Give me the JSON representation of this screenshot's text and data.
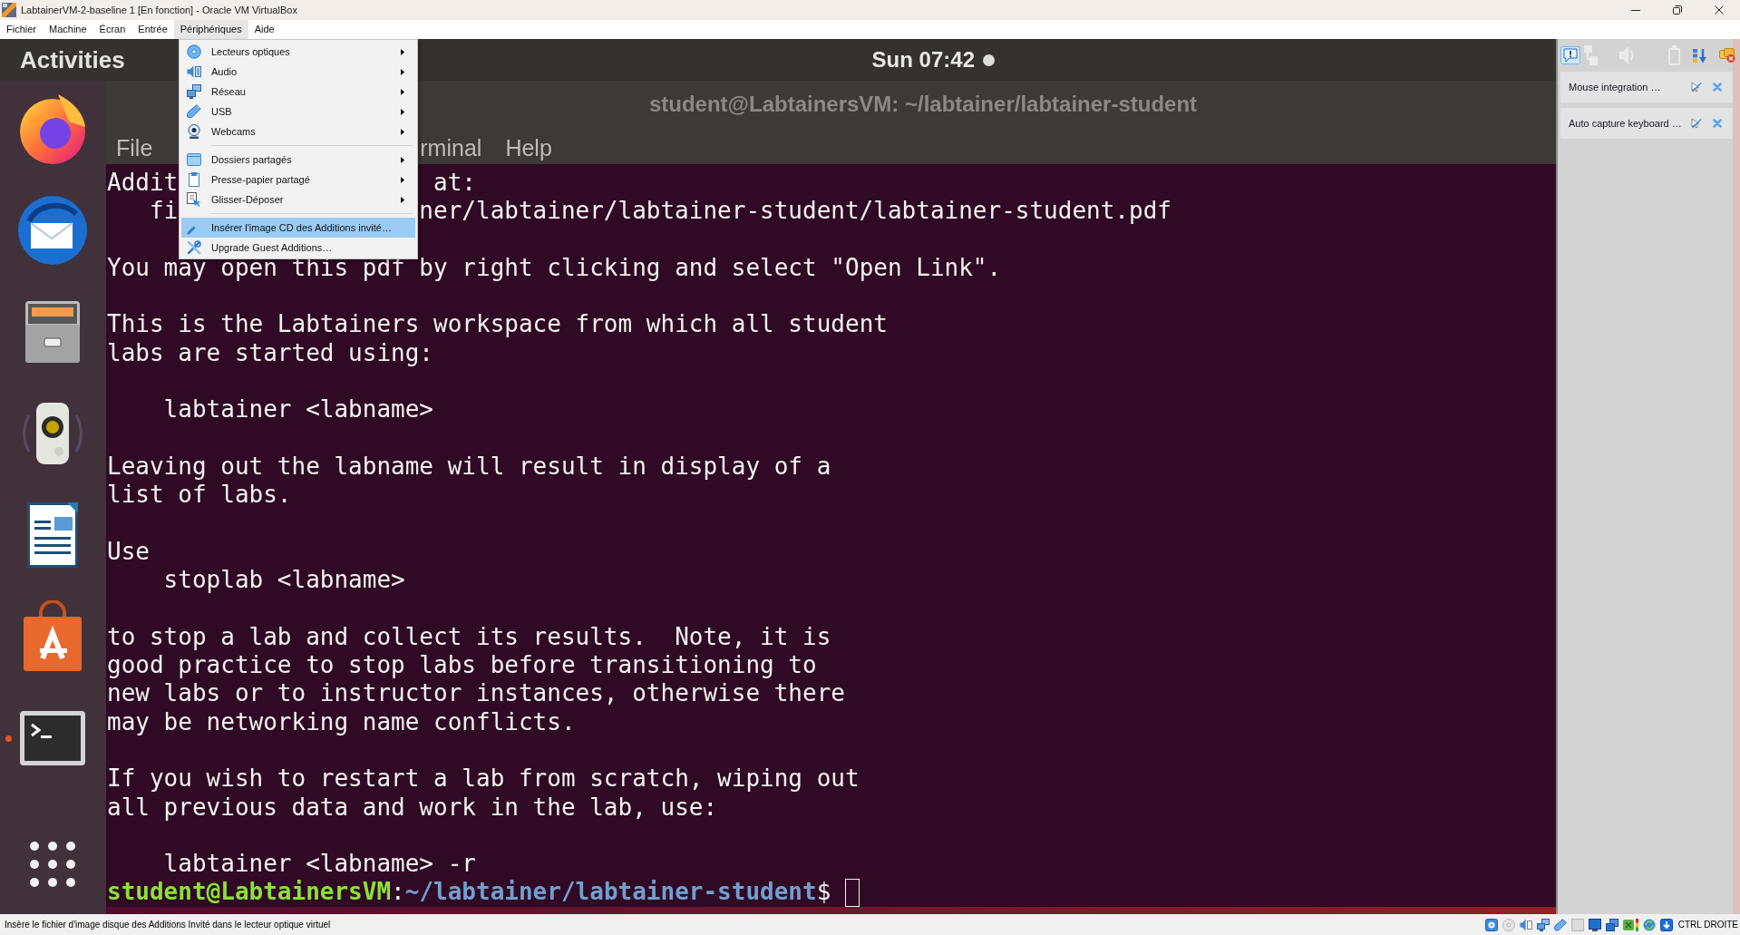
{
  "window": {
    "title": "LabtainerVM-2-baseline 1 [En fonction] - Oracle VM VirtualBox"
  },
  "menu_bar": [
    {
      "label": "Fichier",
      "selected": false
    },
    {
      "label": "Machine",
      "selected": false
    },
    {
      "label": "Écran",
      "selected": false
    },
    {
      "label": "Entrée",
      "selected": false
    },
    {
      "label": "Périphériques",
      "selected": true
    },
    {
      "label": "Aide",
      "selected": false
    }
  ],
  "dropdown": {
    "groups": [
      [
        {
          "label": "Lecteurs optiques",
          "submenu": true,
          "highlighted": false
        },
        {
          "label": "Audio",
          "submenu": true,
          "highlighted": false
        },
        {
          "label": "Réseau",
          "submenu": true,
          "highlighted": false
        },
        {
          "label": "USB",
          "submenu": true,
          "highlighted": false
        },
        {
          "label": "Webcams",
          "submenu": true,
          "highlighted": false
        }
      ],
      [
        {
          "label": "Dossiers partagés",
          "submenu": true,
          "highlighted": false
        },
        {
          "label": "Presse-papier partagé",
          "submenu": true,
          "highlighted": false
        },
        {
          "label": "Glisser-Déposer",
          "submenu": true,
          "highlighted": false
        }
      ],
      [
        {
          "label": "Insérer l'image CD des Additions invité…",
          "submenu": false,
          "highlighted": true
        },
        {
          "label": "Upgrade Guest Additions…",
          "submenu": false,
          "highlighted": false
        }
      ]
    ]
  },
  "vm": {
    "top_bar": {
      "activities": "Activities",
      "clock": "Sun 07:42"
    },
    "dock": {
      "items": [
        {
          "running": false
        },
        {
          "running": false
        },
        {
          "running": false
        },
        {
          "running": false
        },
        {
          "running": false
        },
        {
          "running": false
        },
        {
          "running": true
        }
      ]
    },
    "terminal": {
      "title": "student@LabtainersVM: ~/labtainer/labtainer-student",
      "menu": [
        "File",
        "rminal",
        "Help"
      ],
      "blocks": [
        [
          {
            "kind": "split",
            "segments": [
              "Addit",
              "at:"
            ]
          },
          {
            "kind": "split",
            "segments": [
              "fi",
              "ner/labtainer/labtainer-student/labtainer-student.pdf"
            ]
          }
        ],
        [
          {
            "kind": "plain",
            "text": "You may open this pdf by right clicking and select \"Open Link\"."
          }
        ],
        [
          {
            "kind": "plain",
            "text": "This is the Labtainers workspace from which all student"
          },
          {
            "kind": "plain",
            "text": "labs are started using:"
          }
        ],
        [
          {
            "kind": "indented",
            "text": "labtainer <labname>"
          }
        ],
        [
          {
            "kind": "plain",
            "text": "Leaving out the labname will result in display of a"
          },
          {
            "kind": "plain",
            "text": "list of labs."
          }
        ],
        [
          {
            "kind": "plain",
            "text": "Use"
          },
          {
            "kind": "indented",
            "text": "stoplab <labname>"
          }
        ],
        [
          {
            "kind": "plain",
            "text": "to stop a lab and collect its results.  Note, it is"
          },
          {
            "kind": "plain",
            "text": "good practice to stop labs before transitioning to"
          },
          {
            "kind": "plain",
            "text": "new labs or to instructor instances, otherwise there"
          },
          {
            "kind": "plain",
            "text": "may be networking name conflicts."
          }
        ],
        [
          {
            "kind": "plain",
            "text": "If you wish to restart a lab from scratch, wiping out"
          },
          {
            "kind": "plain",
            "text": "all previous data and work in the lab, use:"
          }
        ],
        [
          {
            "kind": "indented",
            "text": "labtainer <labname> -r"
          }
        ]
      ],
      "prompt": {
        "user_host": "student@LabtainersVM",
        "separator": ":",
        "path": "~/labtainer/labtainer-student",
        "symbol": "$"
      }
    },
    "notifications": [
      {
        "text": "Mouse integration …"
      },
      {
        "text": "Auto capture keyboard …"
      }
    ]
  },
  "status_bar": {
    "message": "Insère le fichier d'image disque des Additions Invité dans le lecteur optique virtuel",
    "host_key": "CTRL DROITE"
  }
}
